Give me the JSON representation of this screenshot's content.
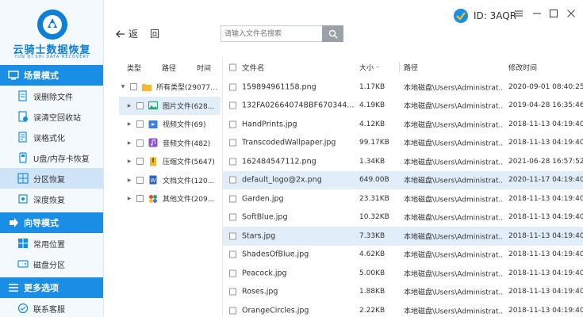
{
  "app": {
    "name": "云骑士数据恢复",
    "subtitle": "YUN QI SHI DATA RECOVERY",
    "id_label": "ID: 3AQR"
  },
  "sidebar": {
    "sections": [
      {
        "title": "场景模式",
        "icon": "monitor-icon",
        "items": [
          {
            "label": "误删除文件",
            "icon": "delete-file-icon",
            "active": false
          },
          {
            "label": "误清空回收站",
            "icon": "recycle-bin-icon",
            "active": false
          },
          {
            "label": "误格式化",
            "icon": "format-icon",
            "active": false
          },
          {
            "label": "U盘/内存卡恢复",
            "icon": "usb-icon",
            "active": false
          },
          {
            "label": "分区恢复",
            "icon": "partition-icon",
            "active": true
          },
          {
            "label": "深度恢复",
            "icon": "deep-scan-icon",
            "active": false
          }
        ]
      },
      {
        "title": "向导模式",
        "icon": "guide-icon",
        "items": [
          {
            "label": "常用位置",
            "icon": "windows-icon",
            "active": false
          },
          {
            "label": "磁盘分区",
            "icon": "disk-icon",
            "active": false
          }
        ]
      },
      {
        "title": "更多选项",
        "icon": "menu-icon",
        "items": [
          {
            "label": "联系客服",
            "icon": "support-icon",
            "active": false
          }
        ]
      }
    ]
  },
  "toolbar": {
    "back_label": "返",
    "return_label": "回",
    "search_placeholder": "请输入文件名搜索"
  },
  "tree": {
    "headers": {
      "type": "类型",
      "path": "路径",
      "time": "时间"
    },
    "items": [
      {
        "label": "所有类型(29077...",
        "icon": "folder-icon",
        "caret": "▼",
        "level": 0,
        "selected": false
      },
      {
        "label": "图片文件(628...",
        "icon": "image-icon",
        "caret": "▶",
        "level": 1,
        "selected": true
      },
      {
        "label": "视频文件(69)",
        "icon": "video-icon",
        "caret": "▶",
        "level": 1,
        "selected": false
      },
      {
        "label": "音频文件(482)",
        "icon": "audio-icon",
        "caret": "▶",
        "level": 1,
        "selected": false
      },
      {
        "label": "压缩文件(5647)",
        "icon": "archive-icon",
        "caret": "▶",
        "level": 1,
        "selected": false
      },
      {
        "label": "文档文件(120...",
        "icon": "document-icon",
        "caret": "▶",
        "level": 1,
        "selected": false
      },
      {
        "label": "其他文件(209...",
        "icon": "other-files-icon",
        "caret": "▶",
        "level": 1,
        "selected": false
      }
    ]
  },
  "file_list": {
    "headers": {
      "name": "文件名",
      "size": "大小",
      "path": "路径",
      "time": "修改时间"
    },
    "rows": [
      {
        "name": "159894961158.png",
        "size": "1.17KB",
        "path": "本地磁盘\\Users\\Administrat...",
        "time": "2020-09-01 08:40:25",
        "selected": false
      },
      {
        "name": "132FA02664074BBF670344...",
        "size": "4.19KB",
        "path": "本地磁盘\\Users\\Administrat...",
        "time": "2019-04-28 16:35:46",
        "selected": false
      },
      {
        "name": "HandPrints.jpg",
        "size": "4.12KB",
        "path": "本地磁盘\\Users\\Administrat...",
        "time": "2018-11-13 04:19:40",
        "selected": false
      },
      {
        "name": "TranscodedWallpaper.jpg",
        "size": "99.17KB",
        "path": "本地磁盘\\Users\\Administrat...",
        "time": "2018-11-13 04:19:40",
        "selected": false
      },
      {
        "name": "162484547112.png",
        "size": "1.34KB",
        "path": "本地磁盘\\Users\\Administrat...",
        "time": "2021-06-28 16:57:52",
        "selected": false
      },
      {
        "name": "default_logo@2x.png",
        "size": "649.00B",
        "path": "本地磁盘\\Users\\Administrat...",
        "time": "2020-11-17 04:19:40",
        "selected": true
      },
      {
        "name": "Garden.jpg",
        "size": "23.31KB",
        "path": "本地磁盘\\Users\\Administrat...",
        "time": "2018-11-13 04:19:40",
        "selected": false
      },
      {
        "name": "SoftBlue.jpg",
        "size": "10.32KB",
        "path": "本地磁盘\\Users\\Administrat...",
        "time": "2018-11-13 04:19:40",
        "selected": false
      },
      {
        "name": "Stars.jpg",
        "size": "7.33KB",
        "path": "本地磁盘\\Users\\Administrat...",
        "time": "2018-11-13 04:19:40",
        "selected": true
      },
      {
        "name": "ShadesOfBlue.jpg",
        "size": "4.62KB",
        "path": "本地磁盘\\Users\\Administrat...",
        "time": "2018-11-13 04:19:40",
        "selected": false
      },
      {
        "name": "Peacock.jpg",
        "size": "5.00KB",
        "path": "本地磁盘\\Users\\Administrat...",
        "time": "2018-11-13 04:19:40",
        "selected": false
      },
      {
        "name": "Roses.jpg",
        "size": "1.88KB",
        "path": "本地磁盘\\Users\\Administrat...",
        "time": "2018-11-13 04:19:40",
        "selected": false
      },
      {
        "name": "OrangeCircles.jpg",
        "size": "2.22KB",
        "path": "本地磁盘\\Users\\Administrat...",
        "time": "2018-11-13 04:19:40",
        "selected": false
      }
    ]
  },
  "colors": {
    "accent": "#1a8de4",
    "active_nav": "#cfe4f6",
    "selected_row": "#e1eefa"
  }
}
